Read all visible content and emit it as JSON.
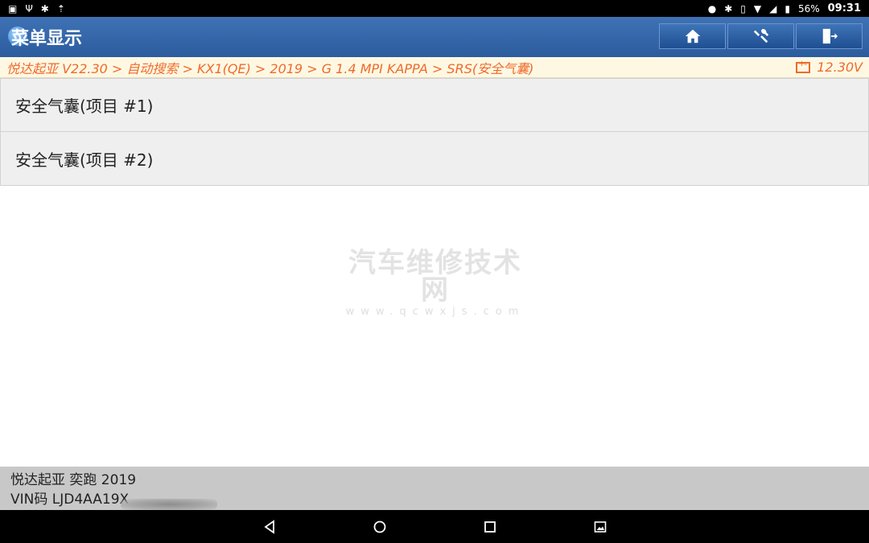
{
  "statusbar": {
    "battery": "56%",
    "time": "09:31"
  },
  "titlebar": {
    "title": "菜单显示"
  },
  "breadcrumb": {
    "path": "悦达起亚 V22.30 > 自动搜索 > KX1(QE) > 2019 > G 1.4 MPI KAPPA > SRS(安全气囊)",
    "voltage": "12.30V"
  },
  "list": {
    "items": [
      {
        "label": "安全气囊(项目 #1)"
      },
      {
        "label": "安全气囊(项目 #2)"
      }
    ]
  },
  "watermark": {
    "title": "汽车维修技术网",
    "url": "www.qcwxjs.com"
  },
  "footer": {
    "vehicle": "悦达起亚 奕跑 2019",
    "vin": "VIN码 LJD4AA19X"
  },
  "colors": {
    "titlebar": "#2b5c9e",
    "breadcrumb_text": "#f06a2b",
    "breadcrumb_bg": "#fef8e3",
    "footer_bg": "#c8c8c8"
  },
  "icons": {
    "home": "home-icon",
    "diagnose": "wrench-icon",
    "exit": "exit-icon",
    "battery": "battery-icon"
  }
}
